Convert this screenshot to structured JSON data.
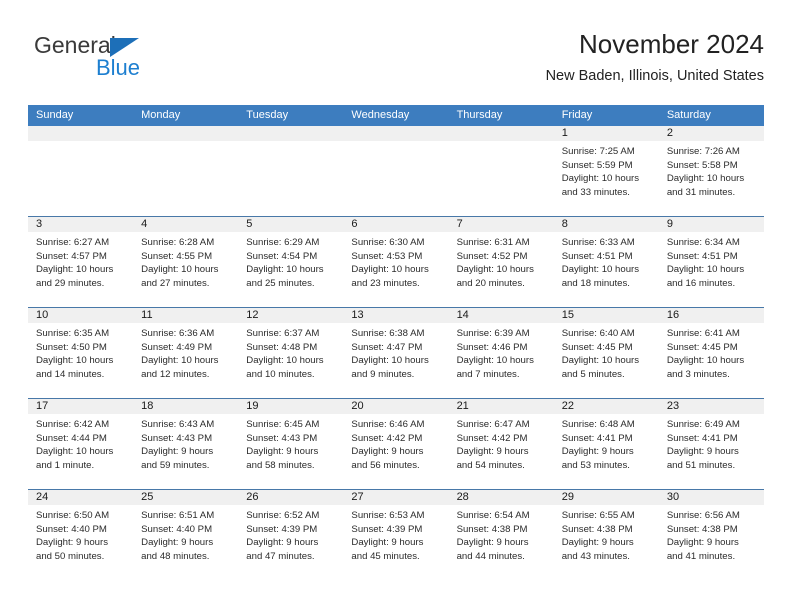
{
  "brand": {
    "name_top": "General",
    "name_bottom": "Blue",
    "triangle_color": "#1d6fb8",
    "blue_text_color": "#1d7fd0"
  },
  "header": {
    "title": "November 2024",
    "subtitle": "New Baden, Illinois, United States"
  },
  "theme": {
    "header_row_bg": "#3d7dbf",
    "header_row_text": "#ffffff",
    "daynum_band_bg": "#f0f0f0",
    "row_divider": "#4878a8"
  },
  "weekdays": [
    "Sunday",
    "Monday",
    "Tuesday",
    "Wednesday",
    "Thursday",
    "Friday",
    "Saturday"
  ],
  "weeks": [
    [
      {
        "day": "",
        "empty": true,
        "lines": [
          "",
          "",
          "",
          ""
        ]
      },
      {
        "day": "",
        "empty": true,
        "lines": [
          "",
          "",
          "",
          ""
        ]
      },
      {
        "day": "",
        "empty": true,
        "lines": [
          "",
          "",
          "",
          ""
        ]
      },
      {
        "day": "",
        "empty": true,
        "lines": [
          "",
          "",
          "",
          ""
        ]
      },
      {
        "day": "",
        "empty": true,
        "lines": [
          "",
          "",
          "",
          ""
        ]
      },
      {
        "day": "1",
        "empty": false,
        "lines": [
          "Sunrise: 7:25 AM",
          "Sunset: 5:59 PM",
          "Daylight: 10 hours",
          "and 33 minutes."
        ]
      },
      {
        "day": "2",
        "empty": false,
        "lines": [
          "Sunrise: 7:26 AM",
          "Sunset: 5:58 PM",
          "Daylight: 10 hours",
          "and 31 minutes."
        ]
      }
    ],
    [
      {
        "day": "3",
        "empty": false,
        "lines": [
          "Sunrise: 6:27 AM",
          "Sunset: 4:57 PM",
          "Daylight: 10 hours",
          "and 29 minutes."
        ]
      },
      {
        "day": "4",
        "empty": false,
        "lines": [
          "Sunrise: 6:28 AM",
          "Sunset: 4:55 PM",
          "Daylight: 10 hours",
          "and 27 minutes."
        ]
      },
      {
        "day": "5",
        "empty": false,
        "lines": [
          "Sunrise: 6:29 AM",
          "Sunset: 4:54 PM",
          "Daylight: 10 hours",
          "and 25 minutes."
        ]
      },
      {
        "day": "6",
        "empty": false,
        "lines": [
          "Sunrise: 6:30 AM",
          "Sunset: 4:53 PM",
          "Daylight: 10 hours",
          "and 23 minutes."
        ]
      },
      {
        "day": "7",
        "empty": false,
        "lines": [
          "Sunrise: 6:31 AM",
          "Sunset: 4:52 PM",
          "Daylight: 10 hours",
          "and 20 minutes."
        ]
      },
      {
        "day": "8",
        "empty": false,
        "lines": [
          "Sunrise: 6:33 AM",
          "Sunset: 4:51 PM",
          "Daylight: 10 hours",
          "and 18 minutes."
        ]
      },
      {
        "day": "9",
        "empty": false,
        "lines": [
          "Sunrise: 6:34 AM",
          "Sunset: 4:51 PM",
          "Daylight: 10 hours",
          "and 16 minutes."
        ]
      }
    ],
    [
      {
        "day": "10",
        "empty": false,
        "lines": [
          "Sunrise: 6:35 AM",
          "Sunset: 4:50 PM",
          "Daylight: 10 hours",
          "and 14 minutes."
        ]
      },
      {
        "day": "11",
        "empty": false,
        "lines": [
          "Sunrise: 6:36 AM",
          "Sunset: 4:49 PM",
          "Daylight: 10 hours",
          "and 12 minutes."
        ]
      },
      {
        "day": "12",
        "empty": false,
        "lines": [
          "Sunrise: 6:37 AM",
          "Sunset: 4:48 PM",
          "Daylight: 10 hours",
          "and 10 minutes."
        ]
      },
      {
        "day": "13",
        "empty": false,
        "lines": [
          "Sunrise: 6:38 AM",
          "Sunset: 4:47 PM",
          "Daylight: 10 hours",
          "and 9 minutes."
        ]
      },
      {
        "day": "14",
        "empty": false,
        "lines": [
          "Sunrise: 6:39 AM",
          "Sunset: 4:46 PM",
          "Daylight: 10 hours",
          "and 7 minutes."
        ]
      },
      {
        "day": "15",
        "empty": false,
        "lines": [
          "Sunrise: 6:40 AM",
          "Sunset: 4:45 PM",
          "Daylight: 10 hours",
          "and 5 minutes."
        ]
      },
      {
        "day": "16",
        "empty": false,
        "lines": [
          "Sunrise: 6:41 AM",
          "Sunset: 4:45 PM",
          "Daylight: 10 hours",
          "and 3 minutes."
        ]
      }
    ],
    [
      {
        "day": "17",
        "empty": false,
        "lines": [
          "Sunrise: 6:42 AM",
          "Sunset: 4:44 PM",
          "Daylight: 10 hours",
          "and 1 minute."
        ]
      },
      {
        "day": "18",
        "empty": false,
        "lines": [
          "Sunrise: 6:43 AM",
          "Sunset: 4:43 PM",
          "Daylight: 9 hours",
          "and 59 minutes."
        ]
      },
      {
        "day": "19",
        "empty": false,
        "lines": [
          "Sunrise: 6:45 AM",
          "Sunset: 4:43 PM",
          "Daylight: 9 hours",
          "and 58 minutes."
        ]
      },
      {
        "day": "20",
        "empty": false,
        "lines": [
          "Sunrise: 6:46 AM",
          "Sunset: 4:42 PM",
          "Daylight: 9 hours",
          "and 56 minutes."
        ]
      },
      {
        "day": "21",
        "empty": false,
        "lines": [
          "Sunrise: 6:47 AM",
          "Sunset: 4:42 PM",
          "Daylight: 9 hours",
          "and 54 minutes."
        ]
      },
      {
        "day": "22",
        "empty": false,
        "lines": [
          "Sunrise: 6:48 AM",
          "Sunset: 4:41 PM",
          "Daylight: 9 hours",
          "and 53 minutes."
        ]
      },
      {
        "day": "23",
        "empty": false,
        "lines": [
          "Sunrise: 6:49 AM",
          "Sunset: 4:41 PM",
          "Daylight: 9 hours",
          "and 51 minutes."
        ]
      }
    ],
    [
      {
        "day": "24",
        "empty": false,
        "lines": [
          "Sunrise: 6:50 AM",
          "Sunset: 4:40 PM",
          "Daylight: 9 hours",
          "and 50 minutes."
        ]
      },
      {
        "day": "25",
        "empty": false,
        "lines": [
          "Sunrise: 6:51 AM",
          "Sunset: 4:40 PM",
          "Daylight: 9 hours",
          "and 48 minutes."
        ]
      },
      {
        "day": "26",
        "empty": false,
        "lines": [
          "Sunrise: 6:52 AM",
          "Sunset: 4:39 PM",
          "Daylight: 9 hours",
          "and 47 minutes."
        ]
      },
      {
        "day": "27",
        "empty": false,
        "lines": [
          "Sunrise: 6:53 AM",
          "Sunset: 4:39 PM",
          "Daylight: 9 hours",
          "and 45 minutes."
        ]
      },
      {
        "day": "28",
        "empty": false,
        "lines": [
          "Sunrise: 6:54 AM",
          "Sunset: 4:38 PM",
          "Daylight: 9 hours",
          "and 44 minutes."
        ]
      },
      {
        "day": "29",
        "empty": false,
        "lines": [
          "Sunrise: 6:55 AM",
          "Sunset: 4:38 PM",
          "Daylight: 9 hours",
          "and 43 minutes."
        ]
      },
      {
        "day": "30",
        "empty": false,
        "lines": [
          "Sunrise: 6:56 AM",
          "Sunset: 4:38 PM",
          "Daylight: 9 hours",
          "and 41 minutes."
        ]
      }
    ]
  ]
}
